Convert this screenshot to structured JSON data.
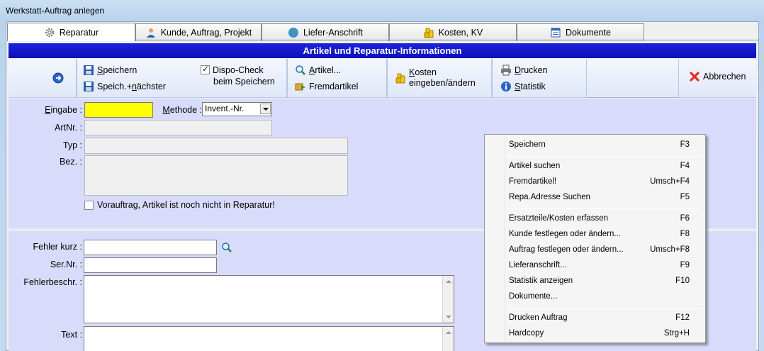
{
  "window": {
    "title": "Werkstatt-Auftrag anlegen"
  },
  "tabs": [
    {
      "label": "Reparatur",
      "icon": "gear-icon"
    },
    {
      "label": "Kunde, Auftrag, Projekt",
      "icon": "person-icon"
    },
    {
      "label": "Liefer-Anschrift",
      "icon": "globe-icon"
    },
    {
      "label": "Kosten, KV",
      "icon": "coins-icon"
    },
    {
      "label": "Dokumente",
      "icon": "document-icon"
    }
  ],
  "header": {
    "title": "Artikel und Reparatur-Informationen"
  },
  "toolbar": {
    "save_u": "S",
    "save_rest": "peichern",
    "savenext_a": "Speich.+",
    "savenext_u": "n",
    "savenext_b": "ächster",
    "dispo_line1": "Dispo-Check",
    "dispo_line2": "beim Speichern",
    "dispo_checked": true,
    "artikel_u": "A",
    "artikel_rest": "rtikel...",
    "fremd": "Fremdartikel",
    "kosten_u": "K",
    "kosten_rest": "osten",
    "kosten_line2": "eingeben/ändern",
    "drucken_u": "D",
    "drucken_rest": "rucken",
    "statistik_u": "S",
    "statistik_rest": "tatistik",
    "abbrechen": "Abbrechen"
  },
  "form": {
    "eingabe_u": "E",
    "eingabe_rest": "ingabe :",
    "eingabe_value": "",
    "methode_u": "M",
    "methode_rest": "ethode :",
    "methode_value": "Invent.-Nr.",
    "artnr_label": "ArtNr. :",
    "typ_label": "Typ :",
    "bez_label": "Bez. :",
    "vorauftrag_label": "Vorauftrag, Artikel ist noch nicht in Reparatur!",
    "vorauftrag_checked": false,
    "fehler_kurz_label": "Fehler kurz :",
    "sernr_label": "Ser.Nr. :",
    "fehlerbeschr_label": "Fehlerbeschr. :",
    "text_label": "Text :"
  },
  "context_menu": {
    "items": [
      {
        "label": "Speichern",
        "shortcut": "F3"
      },
      {
        "label": "Artikel suchen",
        "shortcut": "F4"
      },
      {
        "label": "Fremdartikel!",
        "shortcut": "Umsch+F4"
      },
      {
        "label": "Repa.Adresse Suchen",
        "shortcut": "F5"
      },
      {
        "label": "Ersatzteile/Kosten erfassen",
        "shortcut": "F6"
      },
      {
        "label": "Kunde festlegen oder ändern...",
        "shortcut": "F8"
      },
      {
        "label": "Auftrag festlegen oder ändern...",
        "shortcut": "Umsch+F8"
      },
      {
        "label": "Lieferanschrift...",
        "shortcut": "F9"
      },
      {
        "label": "Statistik anzeigen",
        "shortcut": "F10"
      },
      {
        "label": "Dokumente...",
        "shortcut": ""
      },
      {
        "label": "Drucken Auftrag",
        "shortcut": "F12"
      },
      {
        "label": "Hardcopy",
        "shortcut": "Strg+H"
      }
    ]
  },
  "colors": {
    "header_bg": "#1018c8",
    "eingabe_bg": "#ffff00",
    "panel_bg": "#d8dcfa"
  }
}
